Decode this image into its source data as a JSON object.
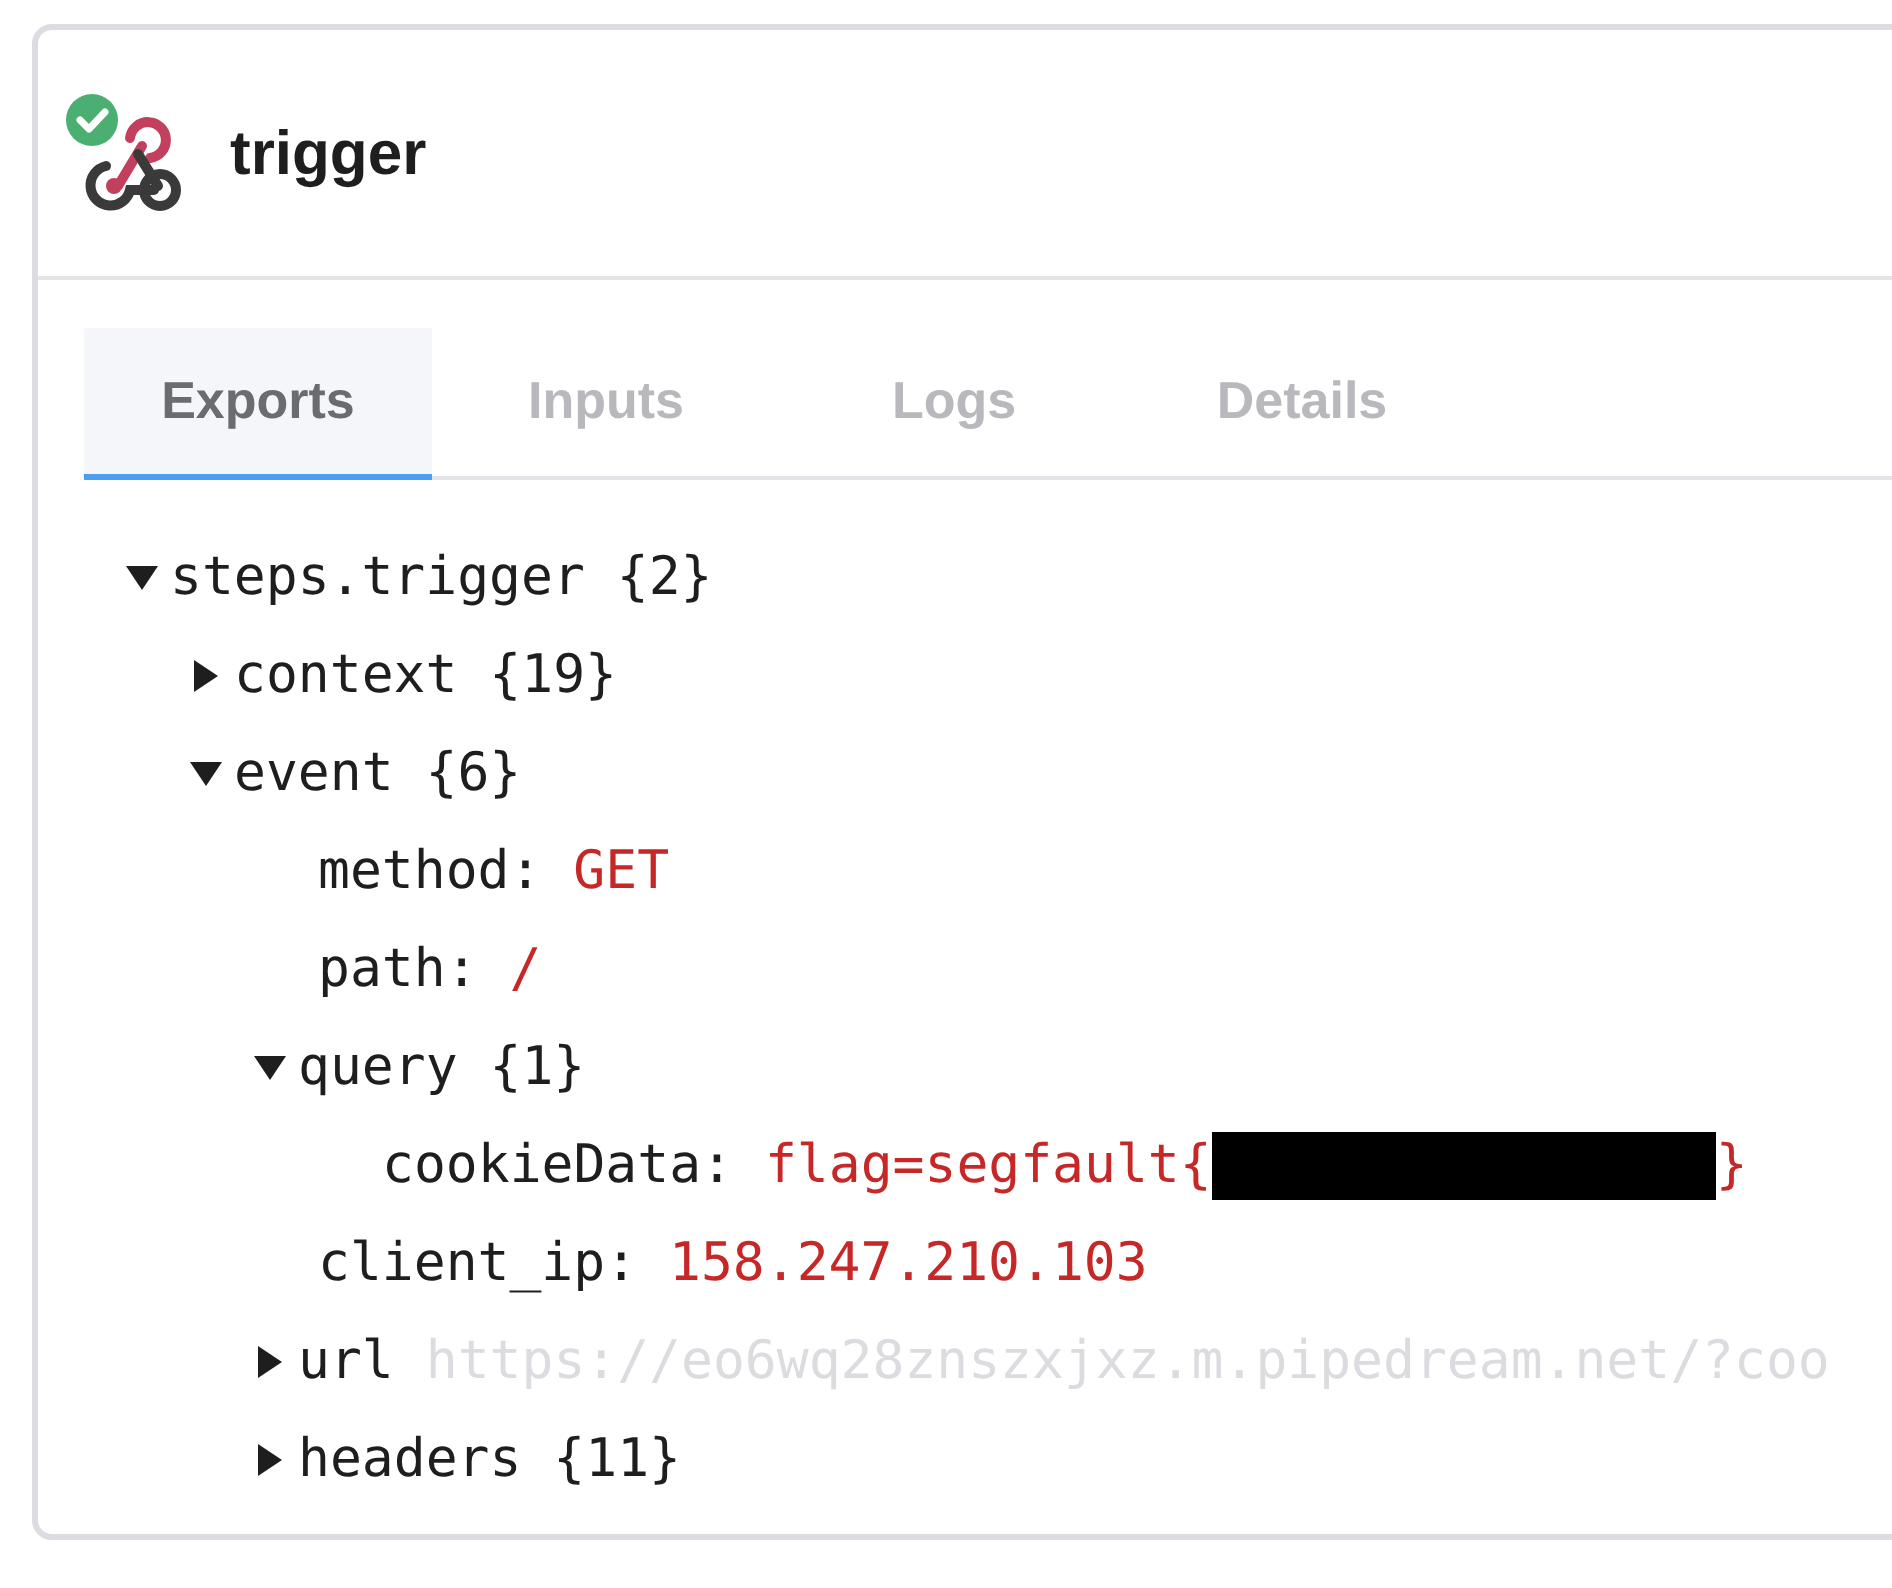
{
  "step": {
    "title": "trigger",
    "succeeded": true
  },
  "tabs": [
    {
      "label": "Exports",
      "selected": true
    },
    {
      "label": "Inputs",
      "selected": false
    },
    {
      "label": "Logs",
      "selected": false
    },
    {
      "label": "Details",
      "selected": false
    }
  ],
  "tree": [
    {
      "kind": "object",
      "key": "steps.trigger",
      "count": "{2}",
      "expanded": true,
      "children": [
        {
          "kind": "object",
          "key": "context",
          "count": "{19}",
          "expanded": false
        },
        {
          "kind": "object",
          "key": "event",
          "count": "{6}",
          "expanded": true,
          "children": [
            {
              "kind": "value",
              "key": "method:",
              "value": "GET"
            },
            {
              "kind": "value",
              "key": "path:",
              "value": "/"
            },
            {
              "kind": "object",
              "key": "query",
              "count": "{1}",
              "expanded": true,
              "children": [
                {
                  "kind": "value",
                  "key": "cookieData:",
                  "value": "flag=segfault{",
                  "redacted": true,
                  "value_end": "}"
                }
              ]
            },
            {
              "kind": "value",
              "key": "client_ip:",
              "value": "158.247.210.103"
            },
            {
              "kind": "preview",
              "key": "url",
              "preview": "https://eo6wq28znszxjxz.m.pipedream.net/?coo",
              "expanded": false
            },
            {
              "kind": "object",
              "key": "headers",
              "count": "{11}",
              "expanded": false
            }
          ]
        }
      ]
    }
  ]
}
